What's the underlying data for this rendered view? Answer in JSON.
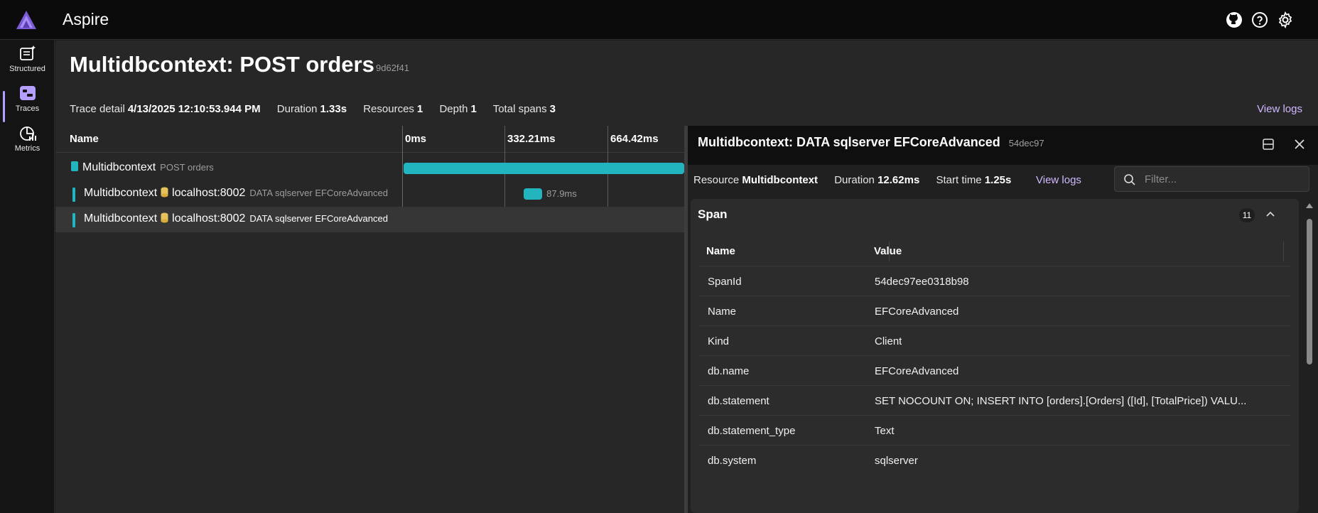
{
  "app": {
    "title": "Aspire"
  },
  "sidebar": {
    "items": [
      {
        "label": "Structured",
        "icon": "structured-logs-icon"
      },
      {
        "label": "Traces",
        "icon": "traces-icon",
        "active": true
      },
      {
        "label": "Metrics",
        "icon": "metrics-icon"
      }
    ]
  },
  "top_icons": [
    "github-icon",
    "help-icon",
    "settings-icon"
  ],
  "page": {
    "title": "Multidbcontext: POST orders",
    "trace_id": "9d62f41",
    "meta": {
      "trace_detail_label": "Trace detail",
      "trace_detail_value": "4/13/2025 12:10:53.944 PM",
      "duration_label": "Duration",
      "duration_value": "1.33s",
      "resources_label": "Resources",
      "resources_value": "1",
      "depth_label": "Depth",
      "depth_value": "1",
      "total_spans_label": "Total spans",
      "total_spans_value": "3"
    },
    "view_logs": "View logs"
  },
  "timeline": {
    "name_header": "Name",
    "ticks": [
      "0ms",
      "332.21ms",
      "664.42ms"
    ],
    "rows": [
      {
        "resource": "Multidbcontext",
        "peer": "",
        "operation": "POST orders",
        "bar_start": 0.0,
        "bar_width": 1.0,
        "bar_label": ""
      },
      {
        "resource": "Multidbcontext",
        "peer": "localhost:8002",
        "operation": "DATA sqlserver EFCoreAdvanced",
        "bar_start": 0.428,
        "bar_width": 0.066,
        "bar_label": "87.9ms"
      },
      {
        "resource": "Multidbcontext",
        "peer": "localhost:8002",
        "operation": "DATA sqlserver EFCoreAdvanced",
        "bar_start": 0.94,
        "bar_width": 0.0095,
        "bar_label": "",
        "selected": true
      }
    ]
  },
  "detail": {
    "title": "Multidbcontext: DATA sqlserver EFCoreAdvanced",
    "span_id_short": "54dec97",
    "resource_label": "Resource",
    "resource_value": "Multidbcontext",
    "duration_label": "Duration",
    "duration_value": "12.62ms",
    "start_label": "Start time",
    "start_value": "1.25s",
    "view_logs": "View logs",
    "filter_placeholder": "Filter...",
    "section": {
      "title": "Span",
      "count": "11",
      "col_name": "Name",
      "col_value": "Value",
      "rows": [
        {
          "name": "SpanId",
          "value": "54dec97ee0318b98"
        },
        {
          "name": "Name",
          "value": "EFCoreAdvanced"
        },
        {
          "name": "Kind",
          "value": "Client"
        },
        {
          "name": "db.name",
          "value": "EFCoreAdvanced"
        },
        {
          "name": "db.statement",
          "value": "SET NOCOUNT ON; INSERT INTO [orders].[Orders] ([Id], [TotalPrice]) VALU..."
        },
        {
          "name": "db.statement_type",
          "value": "Text"
        },
        {
          "name": "db.system",
          "value": "sqlserver"
        }
      ]
    }
  },
  "colors": {
    "accent": "#b6a0ff",
    "span": "#22b5c0",
    "link": "#d0b8ff"
  }
}
